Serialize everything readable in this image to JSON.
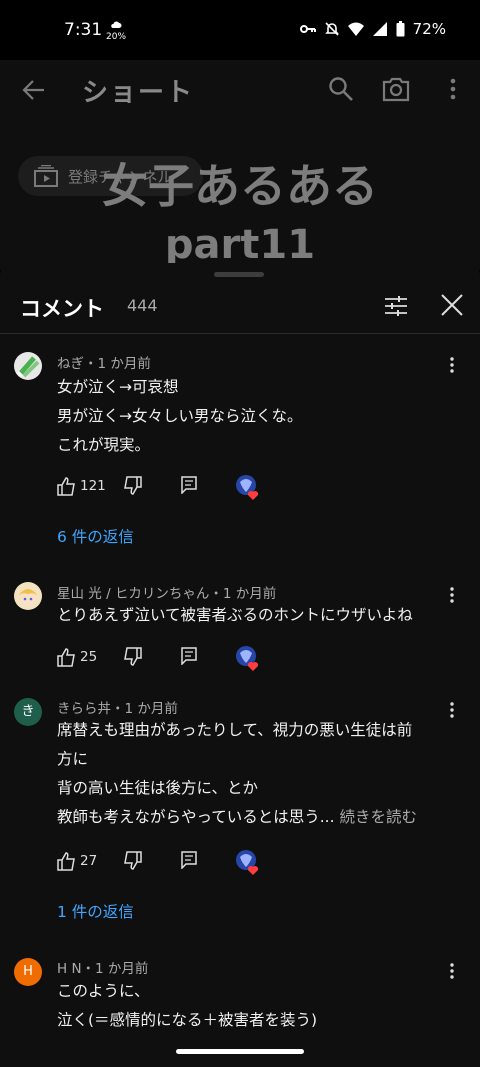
{
  "status": {
    "time": "7:31",
    "weather_pct": "20%",
    "battery": "72%"
  },
  "topbar": {
    "title": "ショート"
  },
  "video": {
    "chip_label": "登録チャンネル",
    "overlay_title": "女子あるある",
    "overlay_sub": "part11"
  },
  "comments_panel": {
    "title": "コメント",
    "count": "444",
    "comments": [
      {
        "meta": "ねぎ・1 か月前",
        "lines": [
          "女が泣く→可哀想",
          "男が泣く→女々しい男なら泣くな。",
          "これが現実。"
        ],
        "likes": "121",
        "replies": "6 件の返信",
        "avatar_color": "#e8e8e8"
      },
      {
        "meta": "星山 光 / ヒカリンちゃん・1 か月前",
        "lines": [
          "とりあえず泣いて被害者ぶるのホントにウザいよね"
        ],
        "likes": "25",
        "avatar_color": "#f3e3c0"
      },
      {
        "meta": "きらら丼・1 か月前",
        "lines": [
          "席替えも理由があったりして、視力の悪い生徒は前",
          "方に",
          "背の高い生徒は後方に、とか",
          "教師も考えながらやっているとは思う..."
        ],
        "more": "続きを読む",
        "likes": "27",
        "replies": "1 件の返信",
        "avatar_letter": "き",
        "avatar_color": "#1f5e4b"
      },
      {
        "meta": "H N・1 か月前",
        "lines": [
          "このように、",
          "泣く(＝感情的になる＋被害者を装う)"
        ],
        "avatar_letter": "H",
        "avatar_color": "#ef6c00"
      }
    ]
  }
}
